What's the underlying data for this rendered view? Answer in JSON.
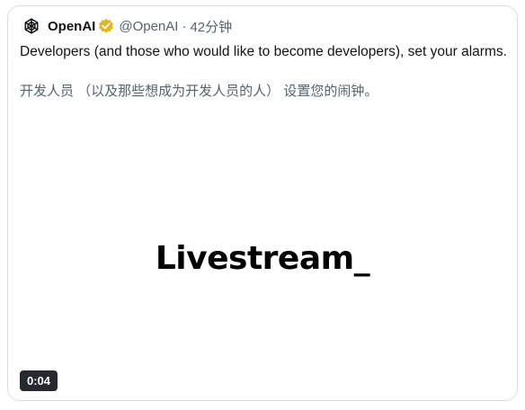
{
  "post": {
    "author_name": "OpenAI",
    "handle": "@OpenAI",
    "separator": "·",
    "time": "42分钟",
    "text_en": "Developers (and those who would like to become developers), set your alarms.",
    "text_zh": "开发人员 （以及那些想成为开发人员的人） 设置您的闹钟。",
    "avatar_icon": "openai-logo-icon",
    "verified_icon": "verified-badge-icon",
    "verified_color": "#e2b719"
  },
  "video": {
    "title": "Livestream_",
    "duration": "0:04"
  }
}
